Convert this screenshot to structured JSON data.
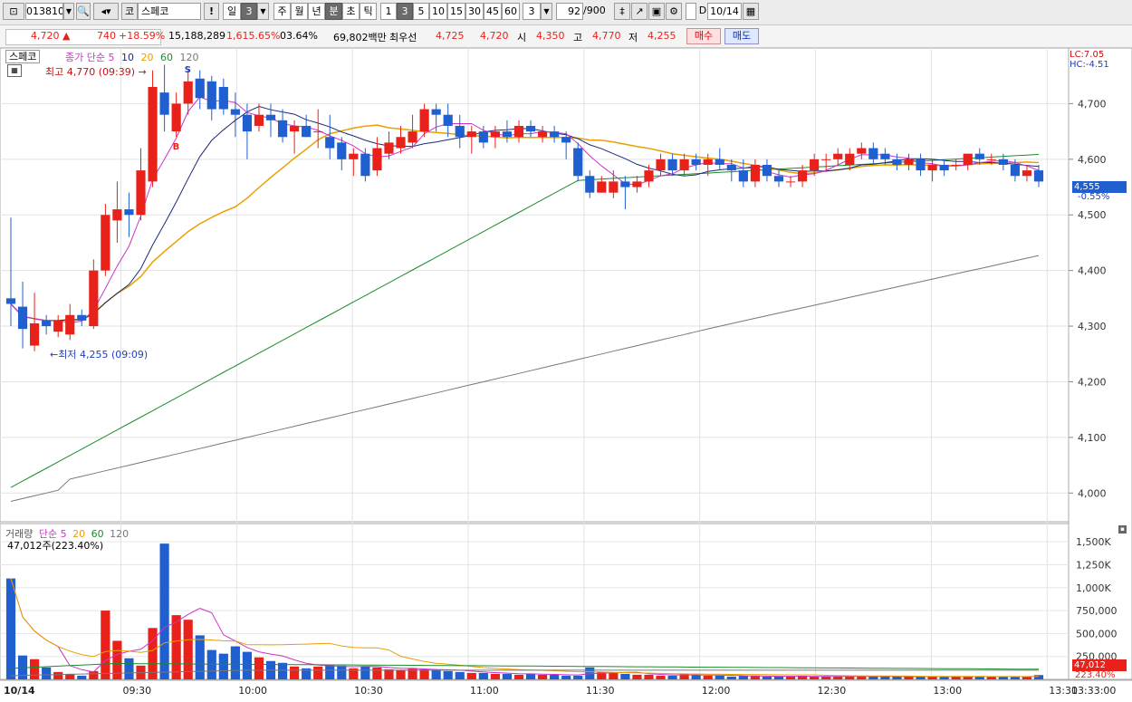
{
  "toolbar": {
    "code": "013810",
    "market": "코",
    "name": "스페코",
    "period_selected": "일",
    "period_num": "3",
    "periods": [
      "주",
      "월",
      "년",
      "분",
      "초",
      "틱"
    ],
    "intervals": [
      "1",
      "3",
      "5",
      "10",
      "15",
      "30",
      "45",
      "60"
    ],
    "interval_sel": "3",
    "count": "92",
    "count_max": "/900",
    "date": "10/14"
  },
  "info": {
    "price": "4,720",
    "change": "740",
    "change_pct": "+18.59%",
    "volume": "15,188,289",
    "volume_pct": "1,615.65%",
    "turnover": "03.64%",
    "amount": "69,802백만",
    "best_bid_label": "최우선",
    "best_ask": "4,725",
    "best_bid": "4,720",
    "open_label": "시",
    "open": "4,350",
    "high_label": "고",
    "high": "4,770",
    "low_label": "저",
    "low": "4,255",
    "buy": "매수",
    "sell": "매도"
  },
  "legend": {
    "name": "스페코",
    "ma_label": "종가 단순 5",
    "ma2": "10",
    "ma3": "20",
    "ma4": "60",
    "ma5": "120",
    "high_note": "최고 4,770 (09:39)",
    "low_note": "최저 4,255 (09:09)",
    "lc": "LC:7.05",
    "hc": "HC:-4.51",
    "cur_price": "4,555",
    "cur_pct": "-0.55%"
  },
  "vol_legend": {
    "label": "거래량",
    "ma": "단순 5",
    "ma2": "20",
    "ma3": "60",
    "ma4": "120",
    "value": "47,012주(223.40%)",
    "cur": "47,012",
    "cur_pct": "223.40%"
  },
  "colors": {
    "up": "#e8221b",
    "down": "#1f5fd0",
    "ma5": "#cc33cc",
    "ma10": "#1a2a7a",
    "ma20": "#e8a000",
    "ma60": "#1c8c2c",
    "ma120": "#777777"
  },
  "chart_data": {
    "type": "candlestick",
    "price_axis": {
      "ticks": [
        4000,
        4100,
        4200,
        4300,
        4400,
        4500,
        4600,
        4700
      ]
    },
    "volume_axis": {
      "ticks": [
        "1,500K",
        "1,250K",
        "1,000K",
        "750,000",
        "500,000",
        "250,000"
      ]
    },
    "x_labels": [
      "10/14",
      "09:30",
      "10:00",
      "10:30",
      "11:00",
      "11:30",
      "12:00",
      "12:30",
      "13:00",
      "13:30",
      "13:33:00"
    ],
    "candles": [
      [
        4350,
        4340,
        4495,
        4300
      ],
      [
        4335,
        4295,
        4380,
        4260
      ],
      [
        4265,
        4305,
        4360,
        4255
      ],
      [
        4310,
        4300,
        4320,
        4285
      ],
      [
        4290,
        4310,
        4320,
        4280
      ],
      [
        4285,
        4320,
        4340,
        4275
      ],
      [
        4320,
        4310,
        4330,
        4300
      ],
      [
        4300,
        4400,
        4420,
        4295
      ],
      [
        4400,
        4500,
        4520,
        4390
      ],
      [
        4490,
        4510,
        4560,
        4450
      ],
      [
        4510,
        4500,
        4540,
        4460
      ],
      [
        4500,
        4580,
        4620,
        4490
      ],
      [
        4560,
        4730,
        4760,
        4550
      ],
      [
        4720,
        4680,
        4770,
        4650
      ],
      [
        4650,
        4700,
        4720,
        4640
      ],
      [
        4700,
        4740,
        4760,
        4680
      ],
      [
        4745,
        4710,
        4760,
        4690
      ],
      [
        4740,
        4690,
        4750,
        4670
      ],
      [
        4730,
        4690,
        4745,
        4680
      ],
      [
        4690,
        4680,
        4720,
        4640
      ],
      [
        4680,
        4650,
        4700,
        4600
      ],
      [
        4660,
        4680,
        4700,
        4650
      ],
      [
        4680,
        4670,
        4700,
        4640
      ],
      [
        4670,
        4640,
        4690,
        4630
      ],
      [
        4650,
        4660,
        4670,
        4610
      ],
      [
        4660,
        4640,
        4680,
        4640
      ],
      [
        4650,
        4650,
        4690,
        4620
      ],
      [
        4640,
        4620,
        4680,
        4600
      ],
      [
        4630,
        4600,
        4640,
        4580
      ],
      [
        4600,
        4610,
        4620,
        4570
      ],
      [
        4610,
        4570,
        4620,
        4560
      ],
      [
        4580,
        4620,
        4640,
        4570
      ],
      [
        4610,
        4630,
        4650,
        4600
      ],
      [
        4620,
        4640,
        4660,
        4610
      ],
      [
        4630,
        4650,
        4680,
        4620
      ],
      [
        4650,
        4690,
        4700,
        4640
      ],
      [
        4690,
        4680,
        4700,
        4650
      ],
      [
        4680,
        4660,
        4700,
        4640
      ],
      [
        4660,
        4640,
        4680,
        4620
      ],
      [
        4640,
        4650,
        4660,
        4610
      ],
      [
        4650,
        4630,
        4660,
        4620
      ],
      [
        4640,
        4650,
        4660,
        4620
      ],
      [
        4650,
        4640,
        4670,
        4630
      ],
      [
        4640,
        4660,
        4670,
        4630
      ],
      [
        4660,
        4650,
        4670,
        4640
      ],
      [
        4640,
        4650,
        4660,
        4630
      ],
      [
        4650,
        4640,
        4660,
        4630
      ],
      [
        4640,
        4630,
        4650,
        4600
      ],
      [
        4620,
        4570,
        4630,
        4560
      ],
      [
        4570,
        4540,
        4580,
        4530
      ],
      [
        4540,
        4560,
        4570,
        4540
      ],
      [
        4540,
        4560,
        4580,
        4530
      ],
      [
        4560,
        4550,
        4570,
        4510
      ],
      [
        4550,
        4560,
        4570,
        4540
      ],
      [
        4560,
        4580,
        4590,
        4550
      ],
      [
        4580,
        4600,
        4610,
        4570
      ],
      [
        4600,
        4580,
        4610,
        4570
      ],
      [
        4580,
        4600,
        4610,
        4570
      ],
      [
        4600,
        4590,
        4610,
        4580
      ],
      [
        4590,
        4600,
        4610,
        4570
      ],
      [
        4600,
        4590,
        4620,
        4580
      ],
      [
        4590,
        4580,
        4600,
        4560
      ],
      [
        4580,
        4560,
        4600,
        4550
      ],
      [
        4560,
        4590,
        4600,
        4550
      ],
      [
        4590,
        4570,
        4600,
        4560
      ],
      [
        4570,
        4560,
        4580,
        4550
      ],
      [
        4560,
        4560,
        4570,
        4550
      ],
      [
        4560,
        4580,
        4590,
        4550
      ],
      [
        4580,
        4600,
        4610,
        4570
      ],
      [
        4600,
        4600,
        4610,
        4580
      ],
      [
        4600,
        4610,
        4620,
        4590
      ],
      [
        4590,
        4610,
        4620,
        4580
      ],
      [
        4610,
        4620,
        4630,
        4600
      ],
      [
        4620,
        4600,
        4630,
        4590
      ],
      [
        4610,
        4600,
        4620,
        4590
      ],
      [
        4600,
        4590,
        4610,
        4580
      ],
      [
        4590,
        4600,
        4610,
        4580
      ],
      [
        4600,
        4580,
        4610,
        4570
      ],
      [
        4580,
        4590,
        4600,
        4560
      ],
      [
        4590,
        4580,
        4600,
        4570
      ],
      [
        4590,
        4590,
        4600,
        4580
      ],
      [
        4590,
        4610,
        4610,
        4580
      ],
      [
        4610,
        4600,
        4620,
        4590
      ],
      [
        4600,
        4600,
        4610,
        4590
      ],
      [
        4600,
        4590,
        4610,
        4580
      ],
      [
        4590,
        4570,
        4600,
        4560
      ],
      [
        4570,
        4580,
        4590,
        4560
      ],
      [
        4580,
        4560,
        4590,
        4550
      ]
    ],
    "volumes": [
      1100,
      260,
      220,
      130,
      80,
      60,
      40,
      90,
      750,
      420,
      230,
      150,
      560,
      1480,
      700,
      650,
      480,
      320,
      280,
      360,
      300,
      240,
      200,
      180,
      140,
      120,
      140,
      160,
      150,
      120,
      140,
      130,
      110,
      100,
      120,
      110,
      100,
      90,
      80,
      70,
      70,
      60,
      60,
      50,
      60,
      50,
      50,
      40,
      40,
      130,
      80,
      70,
      60,
      50,
      50,
      40,
      40,
      60,
      50,
      40,
      40,
      30,
      40,
      40,
      30,
      30,
      30,
      40,
      30,
      30,
      30,
      40,
      30,
      30,
      30,
      30,
      30,
      30,
      30,
      30,
      30,
      30,
      30,
      30,
      30,
      30,
      30,
      47
    ]
  }
}
